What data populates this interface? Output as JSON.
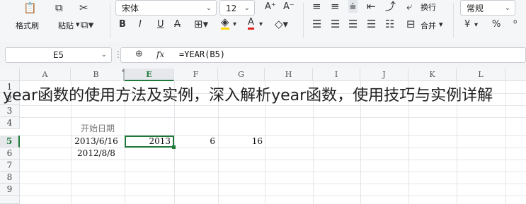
{
  "ribbon": {
    "format_painter_label": "格式刷",
    "paste_label": "粘贴",
    "font_name": "宋体",
    "font_size": "12",
    "bold": "B",
    "italic": "I",
    "underline": "U",
    "wrap_label": "换行",
    "merge_label": "合并",
    "number_format": "常规",
    "currency_symbol": "¥",
    "percent_symbol": "%",
    "accent_colors": {
      "font_color": "#e0201a",
      "fill_color": "#ffd400"
    }
  },
  "formula_bar": {
    "name_box": "E5",
    "fx_label": "fx",
    "formula": "=YEAR(B5)"
  },
  "columns": [
    "A",
    "B",
    "E",
    "F",
    "G",
    "H",
    "I",
    "J",
    "K",
    "L"
  ],
  "rows": [
    "1",
    "2",
    "3",
    "4",
    "5",
    "6",
    "7",
    "8",
    "9"
  ],
  "cells": {
    "b4": "开始日期",
    "b5": "2013/6/16",
    "b6": "2012/8/8",
    "e5": "2013",
    "f5": "6",
    "g5": "16"
  },
  "selected_cell": "E5",
  "overlay_text": "year函数的使用方法及实例，深入解析year函数，使用技巧与实例详解"
}
